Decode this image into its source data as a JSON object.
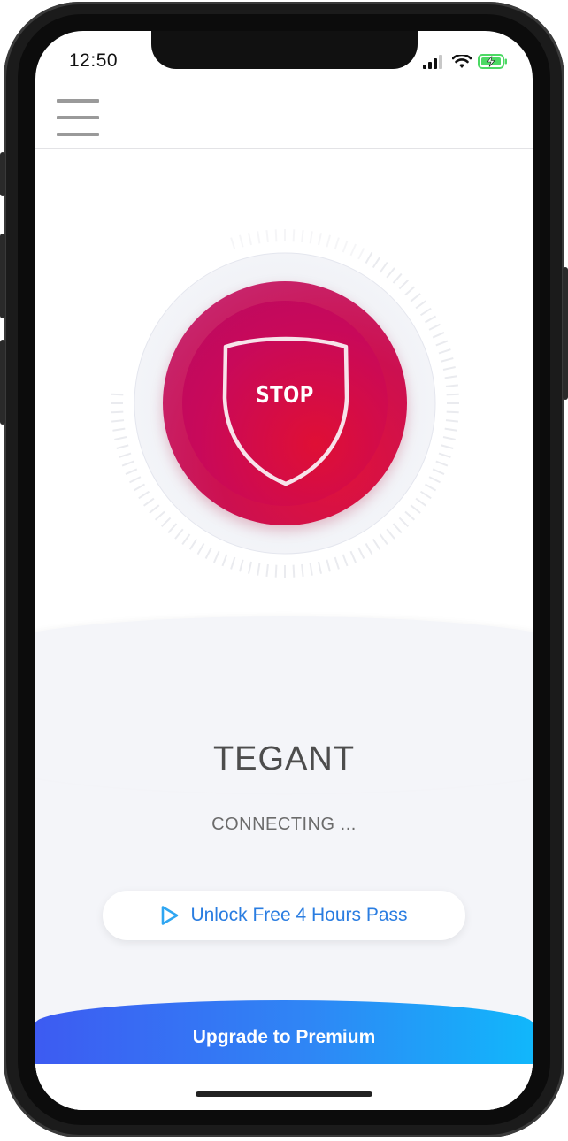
{
  "status_bar": {
    "time": "12:50"
  },
  "toolbar": {
    "menu_icon": "hamburger-menu-icon"
  },
  "connect_button": {
    "label": "STOP",
    "icon": "shield-icon"
  },
  "connection": {
    "server_name": "TEGANT",
    "status": "CONNECTING ..."
  },
  "unlock": {
    "label": "Unlock Free 4 Hours Pass",
    "icon": "play-outline-icon"
  },
  "premium": {
    "label": "Upgrade to Premium"
  },
  "colors": {
    "stop_red": "#df0f35",
    "stop_magenta": "#c5307a",
    "unlock_blue": "#2a7de1",
    "premium_start": "#3d5bf2",
    "premium_end": "#11b7fb",
    "battery_green": "#4cd964"
  }
}
